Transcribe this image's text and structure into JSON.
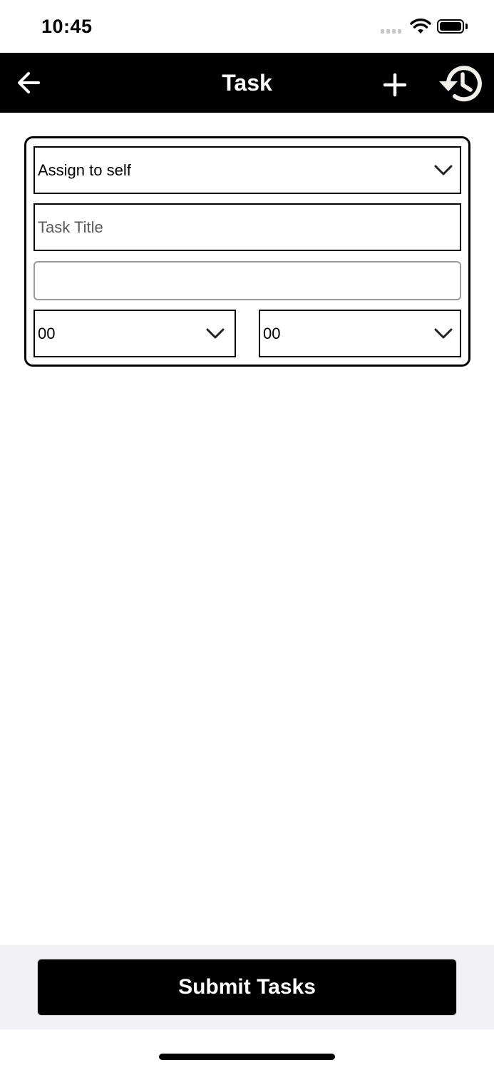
{
  "status_bar": {
    "time": "10:45"
  },
  "nav": {
    "title": "Task",
    "icons": {
      "back": "arrow-left-icon",
      "add": "plus-icon",
      "history": "history-icon"
    }
  },
  "form": {
    "assignee_select": {
      "value": "Assign to self"
    },
    "task_title": {
      "placeholder": "Task Title",
      "value": ""
    },
    "description": {
      "value": ""
    },
    "hour_select": {
      "value": "00"
    },
    "minute_select": {
      "value": "00"
    }
  },
  "submit_label": "Submit Tasks",
  "colors": {
    "nav_bg": "#000000",
    "button_bg": "#000000",
    "bottom_bg": "#f0f0f5"
  }
}
